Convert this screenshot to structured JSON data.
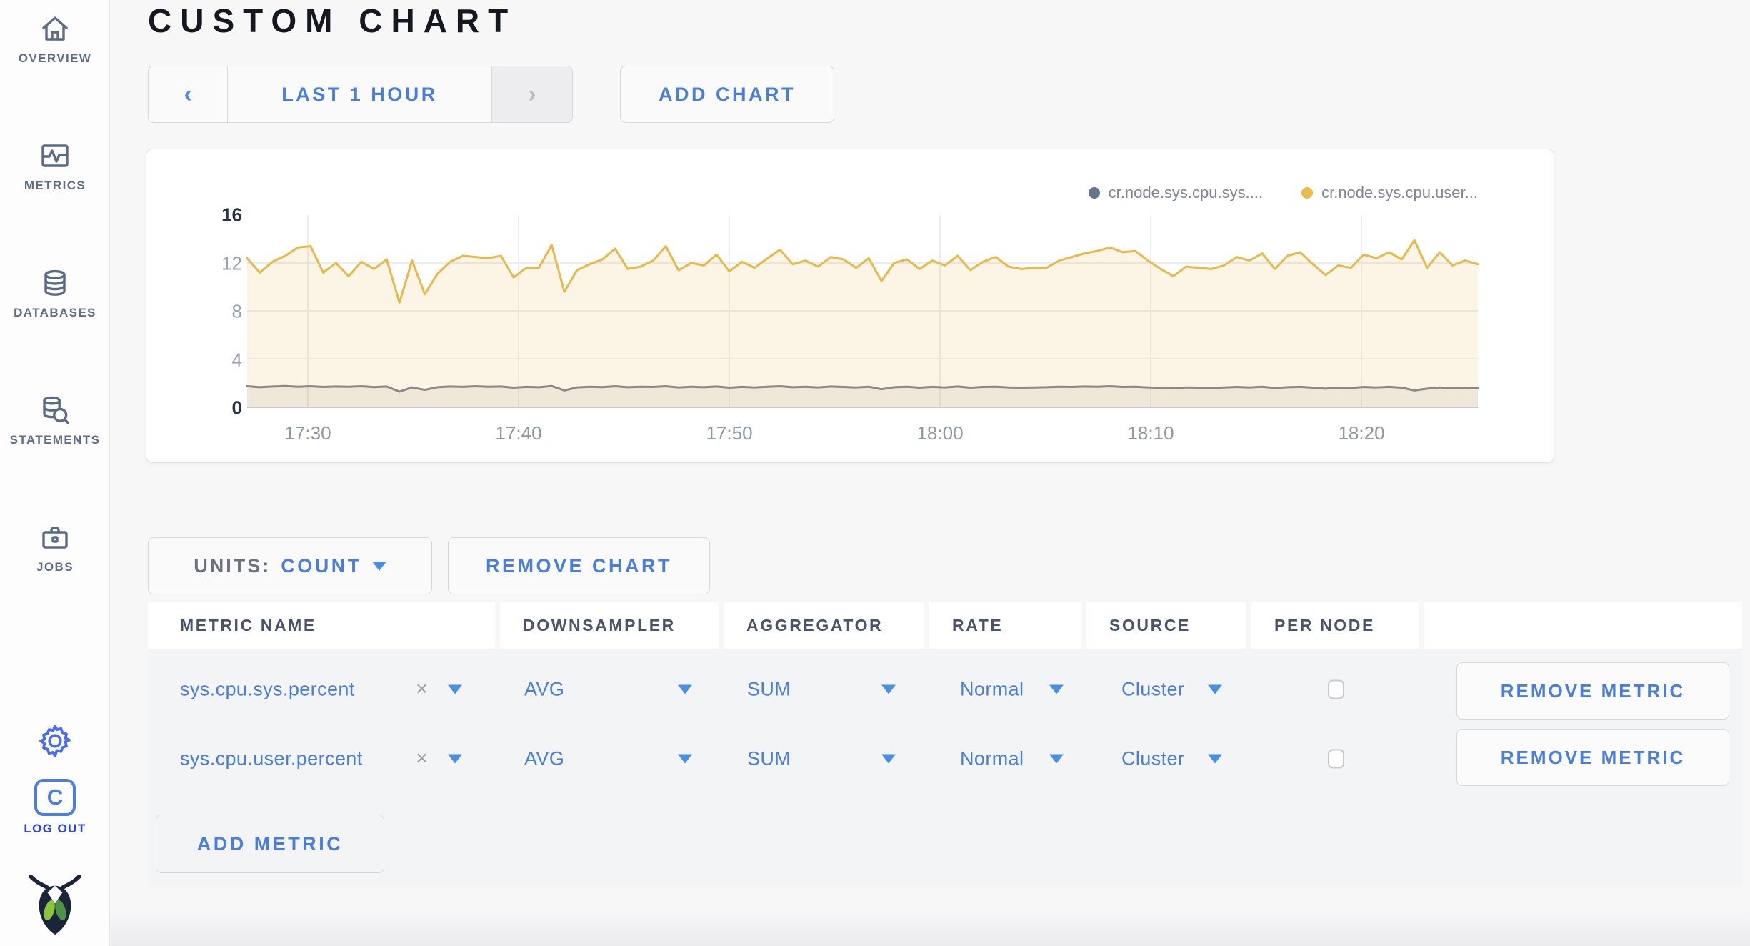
{
  "app": {
    "title": "CUSTOM CHART"
  },
  "sidebar": {
    "items": [
      {
        "label": "OVERVIEW"
      },
      {
        "label": "METRICS"
      },
      {
        "label": "DATABASES"
      },
      {
        "label": "STATEMENTS"
      },
      {
        "label": "JOBS"
      }
    ],
    "logout_label": "LOG OUT",
    "logout_badge_letter": "C"
  },
  "toolbar": {
    "prev_icon": "‹",
    "time_range_label": "LAST 1 HOUR",
    "next_icon": "›",
    "add_chart_label": "ADD CHART"
  },
  "chart_controls": {
    "units_label": "UNITS:",
    "units_value": "COUNT",
    "remove_chart_label": "REMOVE CHART",
    "add_metric_label": "ADD METRIC"
  },
  "chart_data": {
    "type": "line",
    "title": "",
    "xlabel": "",
    "ylabel": "",
    "ylim": [
      0,
      16
    ],
    "y_ticks": [
      16,
      12,
      8,
      4,
      0
    ],
    "x_ticks": [
      "17:30",
      "17:40",
      "17:50",
      "18:00",
      "18:10",
      "18:20"
    ],
    "grid": true,
    "legend_position": "top-right",
    "legend": [
      {
        "label": "cr.node.sys.cpu.sys....",
        "color": "#66748e"
      },
      {
        "label": "cr.node.sys.cpu.user...",
        "color": "#e9ba4d"
      }
    ],
    "series": [
      {
        "name": "cr.node.sys.cpu.user...",
        "color": "#e8b84b",
        "fill": "rgba(233,185,74,0.14)",
        "values": [
          12.4,
          11.2,
          12.1,
          12.6,
          13.3,
          13.4,
          11.2,
          12.0,
          10.9,
          12.1,
          11.5,
          12.3,
          8.7,
          12.2,
          9.4,
          11.1,
          12.1,
          12.6,
          12.5,
          12.4,
          12.6,
          10.8,
          11.6,
          11.6,
          13.5,
          9.6,
          11.4,
          11.9,
          12.3,
          13.2,
          11.5,
          11.7,
          12.2,
          13.4,
          11.4,
          12.0,
          11.8,
          12.7,
          11.3,
          12.1,
          11.6,
          12.4,
          13.1,
          11.9,
          12.2,
          11.7,
          12.5,
          12.3,
          11.6,
          12.4,
          10.5,
          12.0,
          12.3,
          11.5,
          12.2,
          11.8,
          12.6,
          11.4,
          12.1,
          12.5,
          11.7,
          11.5,
          11.6,
          11.6,
          12.2,
          12.5,
          12.8,
          13.0,
          13.3,
          12.9,
          13.0,
          12.2,
          11.5,
          10.9,
          11.7,
          11.6,
          11.5,
          11.8,
          12.5,
          12.2,
          12.8,
          11.5,
          12.6,
          12.9,
          11.9,
          11.0,
          11.8,
          11.6,
          12.7,
          12.4,
          12.9,
          12.3,
          13.9,
          11.6,
          12.9,
          11.8,
          12.2,
          11.9
        ]
      },
      {
        "name": "cr.node.sys.cpu.sys....",
        "color": "#7b8290",
        "fill": "rgba(110,110,104,0.10)",
        "values": [
          1.7,
          1.62,
          1.68,
          1.72,
          1.66,
          1.7,
          1.64,
          1.68,
          1.66,
          1.7,
          1.63,
          1.68,
          1.25,
          1.6,
          1.4,
          1.62,
          1.68,
          1.65,
          1.7,
          1.66,
          1.68,
          1.58,
          1.65,
          1.62,
          1.72,
          1.35,
          1.6,
          1.66,
          1.63,
          1.7,
          1.62,
          1.66,
          1.64,
          1.7,
          1.6,
          1.66,
          1.62,
          1.68,
          1.58,
          1.65,
          1.6,
          1.66,
          1.7,
          1.62,
          1.66,
          1.6,
          1.68,
          1.64,
          1.6,
          1.66,
          1.45,
          1.62,
          1.66,
          1.58,
          1.65,
          1.6,
          1.68,
          1.58,
          1.64,
          1.66,
          1.6,
          1.58,
          1.6,
          1.62,
          1.66,
          1.64,
          1.68,
          1.66,
          1.7,
          1.64,
          1.66,
          1.6,
          1.56,
          1.52,
          1.6,
          1.58,
          1.56,
          1.6,
          1.64,
          1.6,
          1.66,
          1.55,
          1.62,
          1.65,
          1.58,
          1.5,
          1.58,
          1.55,
          1.64,
          1.6,
          1.65,
          1.58,
          1.35,
          1.5,
          1.6,
          1.52,
          1.56,
          1.52
        ]
      }
    ]
  },
  "metrics_table": {
    "headers": [
      "METRIC NAME",
      "DOWNSAMPLER",
      "AGGREGATOR",
      "RATE",
      "SOURCE",
      "PER NODE",
      ""
    ],
    "clear_icon": "×",
    "rows": [
      {
        "metric_name": "sys.cpu.sys.percent",
        "downsampler": "AVG",
        "aggregator": "SUM",
        "rate": "Normal",
        "source": "Cluster",
        "per_node": false,
        "remove_label": "REMOVE METRIC"
      },
      {
        "metric_name": "sys.cpu.user.percent",
        "downsampler": "AVG",
        "aggregator": "SUM",
        "rate": "Normal",
        "source": "Cluster",
        "per_node": false,
        "remove_label": "REMOVE METRIC"
      }
    ]
  }
}
